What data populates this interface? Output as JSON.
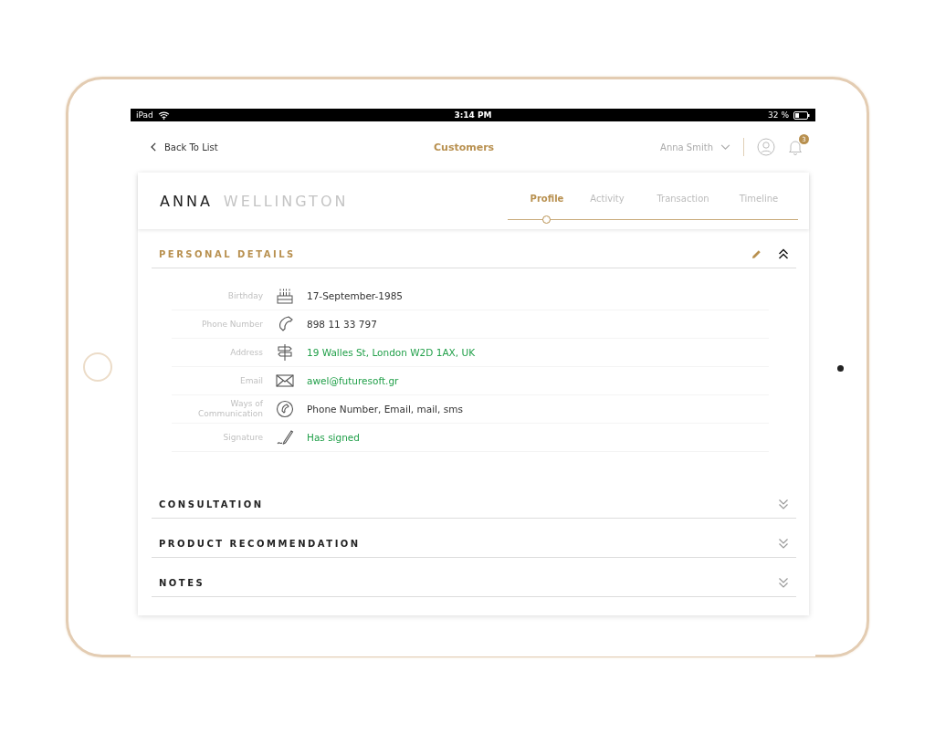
{
  "status_bar": {
    "device": "iPad",
    "time": "3:14 PM",
    "battery": "32 %"
  },
  "nav": {
    "back": "Back To List",
    "title": "Customers",
    "user": "Anna Smith",
    "notifications": "3"
  },
  "customer": {
    "first_name": "ANNA",
    "last_name": "WELLINGTON"
  },
  "tabs": [
    {
      "label": "Profile",
      "selected": true
    },
    {
      "label": "Activity",
      "selected": false
    },
    {
      "label": "Transaction",
      "selected": false
    },
    {
      "label": "Timeline",
      "selected": false
    }
  ],
  "sections": [
    {
      "title": "PERSONAL DETAILS",
      "expanded": true,
      "fields": [
        {
          "label": "Birthday",
          "value": "17-September-1985",
          "kind": "text"
        },
        {
          "label": "Phone Number",
          "value": "898 11 33 797",
          "kind": "text"
        },
        {
          "label": "Address",
          "value": "19 Walles St, London W2D 1AX, UK",
          "kind": "link"
        },
        {
          "label": "Email",
          "value": "awel@futuresoft.gr",
          "kind": "link"
        },
        {
          "label": "Ways of Communication",
          "value": "Phone Number, Email, mail, sms",
          "kind": "text"
        },
        {
          "label": "Signature",
          "value": "Has signed",
          "kind": "link"
        }
      ]
    },
    {
      "title": "CONSULTATION",
      "expanded": false
    },
    {
      "title": "PRODUCT RECOMMENDATION",
      "expanded": false
    },
    {
      "title": "NOTES",
      "expanded": false
    }
  ]
}
